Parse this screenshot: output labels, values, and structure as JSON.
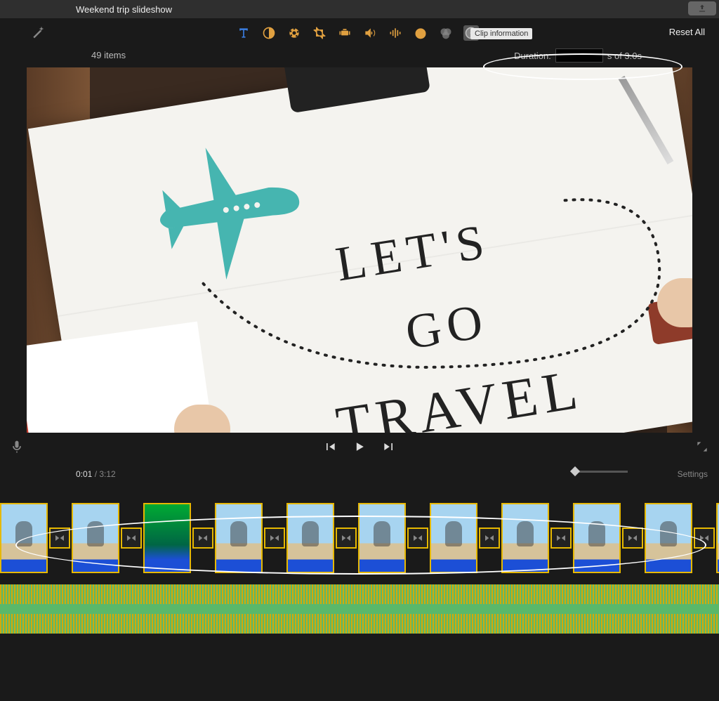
{
  "titlebar": {
    "title": "Weekend trip slideshow"
  },
  "inspector": {
    "reset_label": "Reset All",
    "tooltip": "Clip information"
  },
  "subbar": {
    "items_label": "49 items",
    "duration_label": "Duration:",
    "duration_value": "",
    "duration_suffix": "s of 3.0s"
  },
  "viewer": {
    "line1": "LET'S",
    "line2": "GO",
    "line3": "TRAVEL"
  },
  "timeline": {
    "current_time": "0:01",
    "total_time": "3:12",
    "settings_label": "Settings"
  },
  "clips": [
    {
      "type": "photo"
    },
    {
      "type": "photo"
    },
    {
      "type": "palm"
    },
    {
      "type": "photo"
    },
    {
      "type": "photo"
    },
    {
      "type": "photo"
    },
    {
      "type": "photo"
    },
    {
      "type": "photo"
    },
    {
      "type": "photo"
    },
    {
      "type": "photo"
    },
    {
      "type": "photo"
    }
  ]
}
